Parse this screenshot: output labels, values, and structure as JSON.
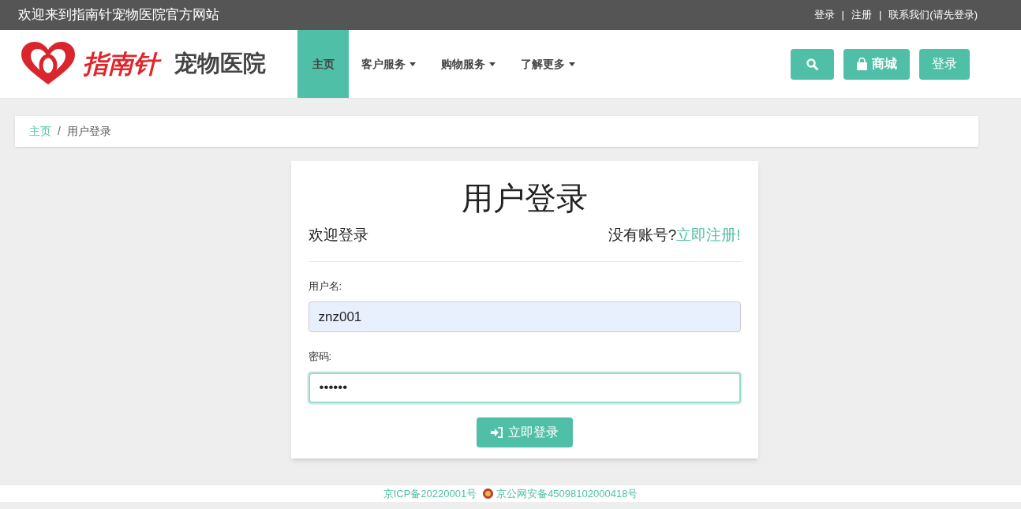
{
  "top_bar": {
    "welcome": "欢迎来到指南针宠物医院官方网站",
    "links": [
      "登录",
      "注册",
      "联系我们(请先登录)"
    ],
    "separator": "|"
  },
  "header": {
    "logo": {
      "brand": "指南针",
      "subtitle": "宠物医院"
    },
    "nav": [
      {
        "label": "主页",
        "selected": true,
        "has_menu": false
      },
      {
        "label": "客户服务",
        "selected": false,
        "has_menu": true
      },
      {
        "label": "购物服务",
        "selected": false,
        "has_menu": true
      },
      {
        "label": "了解更多",
        "selected": false,
        "has_menu": true
      }
    ],
    "buttons": [
      {
        "kind": "search"
      },
      {
        "kind": "shop",
        "label": "商城"
      },
      {
        "kind": "plain",
        "label": "登录"
      }
    ]
  },
  "breadcrumb_separator": "/",
  "breadcrumb": [
    {
      "label": "主页",
      "selected": false
    },
    {
      "label": "用户登录",
      "selected": true
    }
  ],
  "login_card": {
    "title": "用户登录",
    "welcome": "欢迎登录",
    "register_prompt": "没有账号?",
    "register_link": "立即注册!",
    "fields": [
      {
        "label": "用户名:",
        "value": "znz001",
        "autofilled": true,
        "focused": false
      },
      {
        "label": "密码:",
        "value": "••••••",
        "autofilled": false,
        "focused": true
      }
    ],
    "submit": "立即登录"
  },
  "footer": {
    "icp": "京ICP备20220001号",
    "police": "京公网安备45098102000418号"
  }
}
